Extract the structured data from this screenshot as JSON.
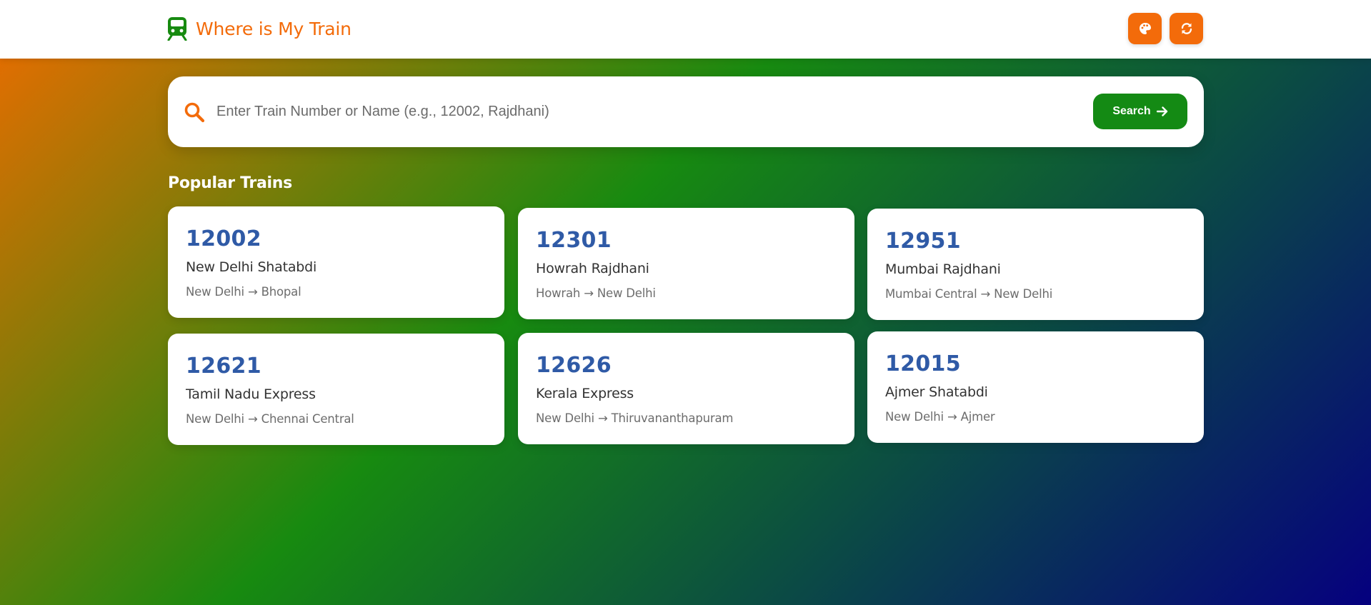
{
  "header": {
    "app_title": "Where is My Train",
    "logo_icon": "train-icon",
    "theme_button_icon": "palette-icon",
    "refresh_button_icon": "refresh-icon",
    "accent_color": "#f36b0a"
  },
  "search": {
    "placeholder": "Enter Train Number or Name (e.g., 12002, Rajdhani)",
    "value": "",
    "button_label": "Search",
    "button_icon": "arrow-right-icon",
    "button_color": "#148a14"
  },
  "popular": {
    "title": "Popular Trains",
    "trains": [
      {
        "number": "12002",
        "name": "New Delhi Shatabdi",
        "route": "New Delhi → Bhopal"
      },
      {
        "number": "12301",
        "name": "Howrah Rajdhani",
        "route": "Howrah → New Delhi"
      },
      {
        "number": "12951",
        "name": "Mumbai Rajdhani",
        "route": "Mumbai Central → New Delhi"
      },
      {
        "number": "12621",
        "name": "Tamil Nadu Express",
        "route": "New Delhi → Chennai Central"
      },
      {
        "number": "12626",
        "name": "Kerala Express",
        "route": "New Delhi → Thiruvananthapuram"
      },
      {
        "number": "12015",
        "name": "Ajmer Shatabdi",
        "route": "New Delhi → Ajmer"
      }
    ]
  }
}
